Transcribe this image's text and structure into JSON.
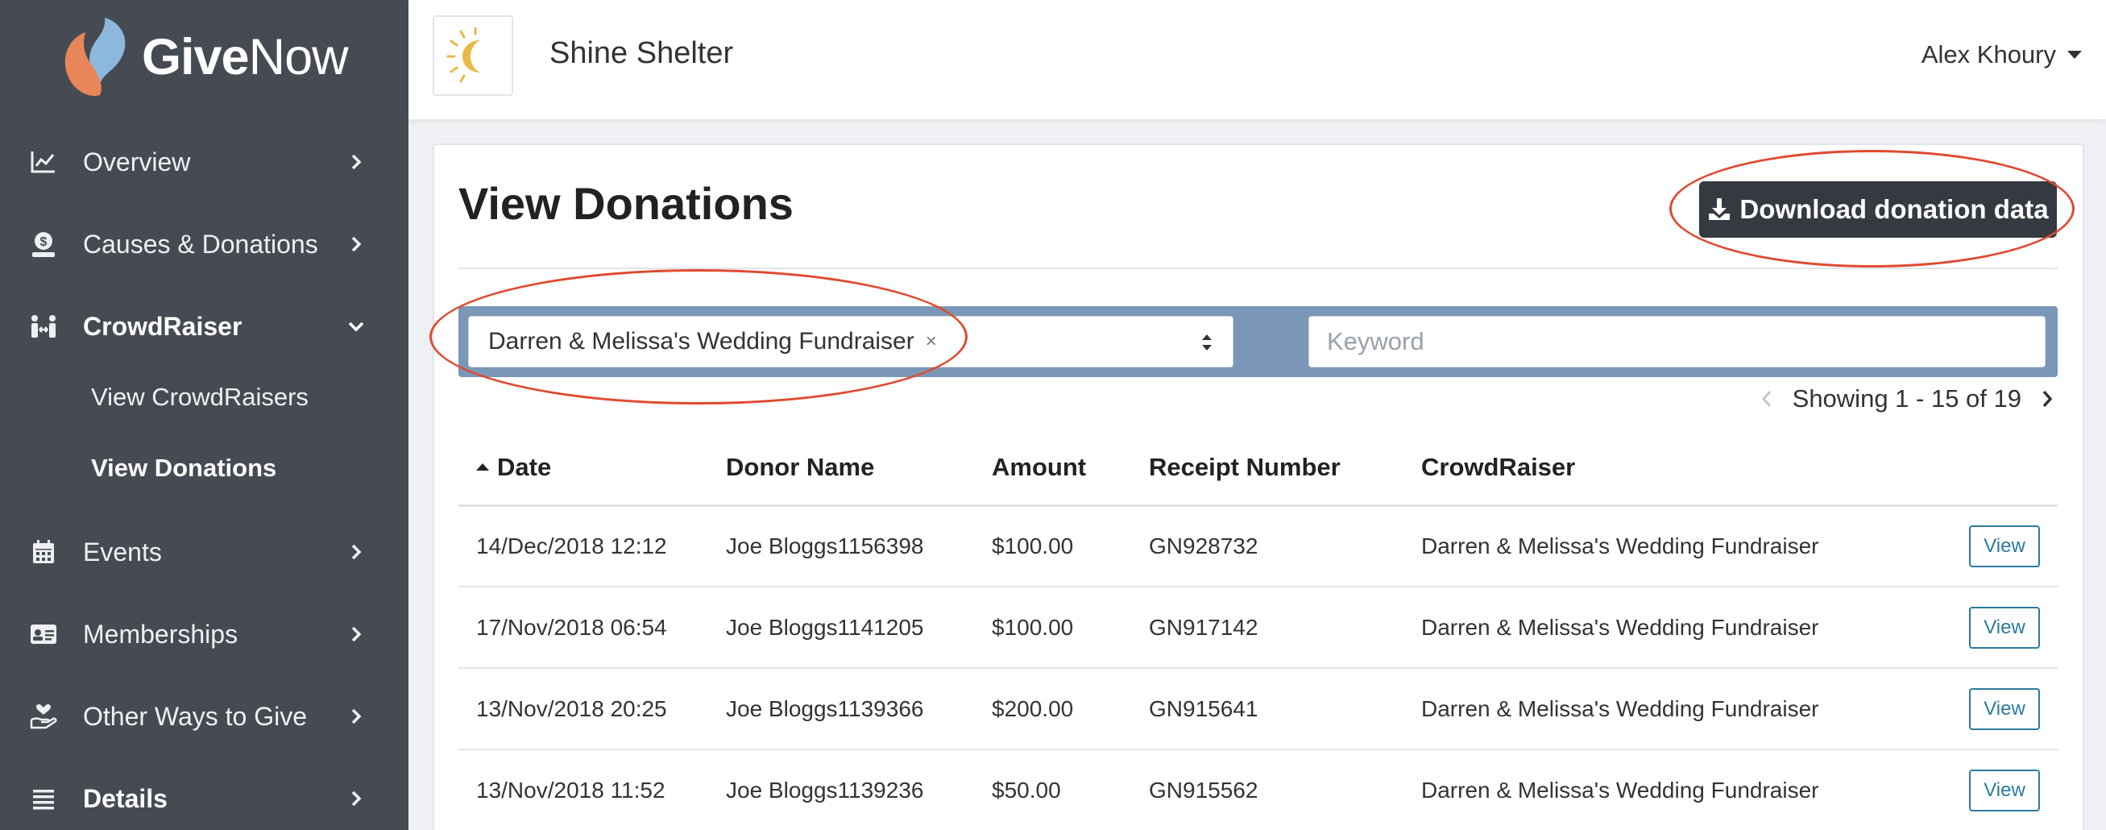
{
  "app": {
    "logo_give": "Give",
    "logo_now": "Now"
  },
  "sidebar": {
    "items": [
      {
        "label": "Overview",
        "icon": "chart-line-icon"
      },
      {
        "label": "Causes & Donations",
        "icon": "donate-icon"
      },
      {
        "label": "CrowdRaiser",
        "icon": "people-arrows-icon"
      },
      {
        "label": "Events",
        "icon": "calendar-icon"
      },
      {
        "label": "Memberships",
        "icon": "id-card-icon"
      },
      {
        "label": "Other Ways to Give",
        "icon": "hand-holding-heart-icon"
      },
      {
        "label": "Details",
        "icon": "list-icon"
      }
    ],
    "sub_items": [
      {
        "label": "View CrowdRaisers"
      },
      {
        "label": "View Donations"
      }
    ]
  },
  "header": {
    "org_name": "Shine Shelter",
    "user_name": "Alex Khoury"
  },
  "main": {
    "title": "View Donations",
    "download_label": "Download donation data",
    "filter": {
      "selected": "Darren & Melissa's Wedding Fundraiser",
      "remove_glyph": "×",
      "keyword_placeholder": "Keyword"
    },
    "pager": {
      "text": "Showing 1 - 15 of 19"
    },
    "table": {
      "headers": [
        "Date",
        "Donor Name",
        "Amount",
        "Receipt Number",
        "CrowdRaiser"
      ],
      "view_label": "View",
      "rows": [
        {
          "date": "14/Dec/2018 12:12",
          "donor": "Joe Bloggs1156398",
          "amount": "$100.00",
          "receipt": "GN928732",
          "crowdraiser": "Darren & Melissa's Wedding Fundraiser"
        },
        {
          "date": "17/Nov/2018 06:54",
          "donor": "Joe Bloggs1141205",
          "amount": "$100.00",
          "receipt": "GN917142",
          "crowdraiser": "Darren & Melissa's Wedding Fundraiser"
        },
        {
          "date": "13/Nov/2018 20:25",
          "donor": "Joe Bloggs1139366",
          "amount": "$200.00",
          "receipt": "GN915641",
          "crowdraiser": "Darren & Melissa's Wedding Fundraiser"
        },
        {
          "date": "13/Nov/2018 11:52",
          "donor": "Joe Bloggs1139236",
          "amount": "$50.00",
          "receipt": "GN915562",
          "crowdraiser": "Darren & Melissa's Wedding Fundraiser"
        }
      ]
    }
  },
  "colors": {
    "sidebar_bg": "#464b53",
    "filter_bar": "#7a97b7",
    "button_dark": "#343a40",
    "link_teal": "#2b7a9f",
    "annotation_red": "#e04a2f",
    "logo_orange": "#e8865a",
    "logo_blue": "#8db8de"
  }
}
